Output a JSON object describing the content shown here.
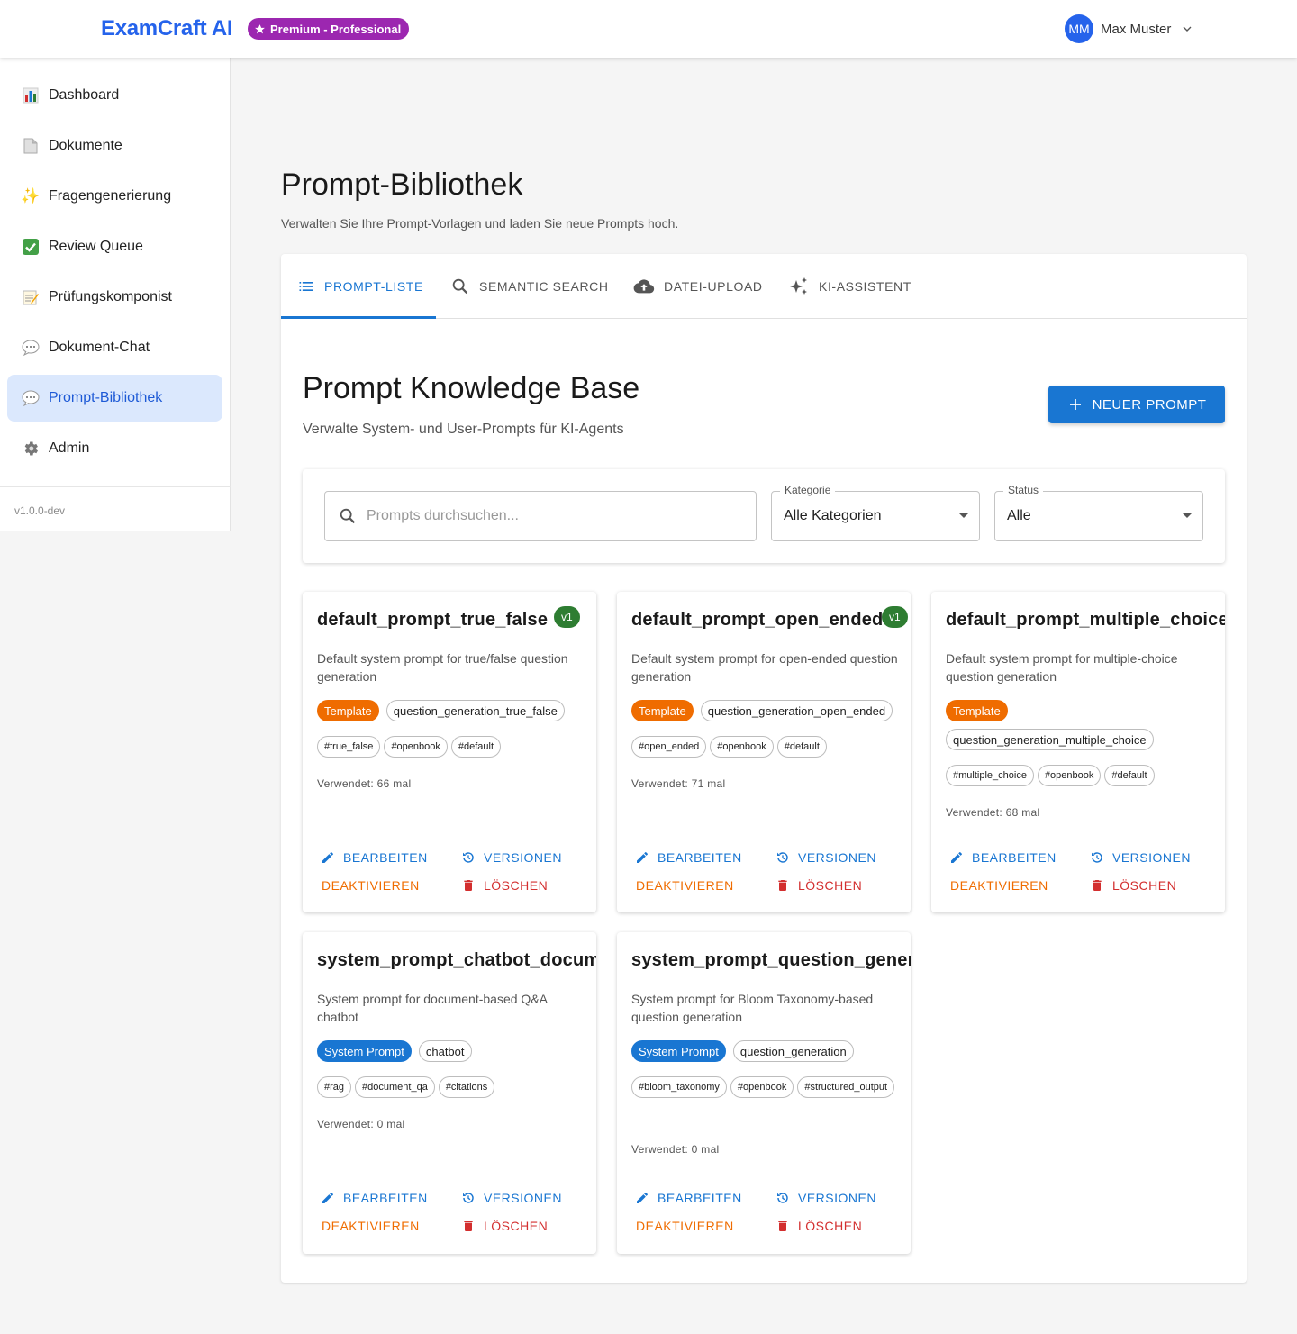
{
  "header": {
    "brand": "ExamCraft AI",
    "plan_badge": "Premium - Professional",
    "user_initials": "MM",
    "user_name": "Max Muster"
  },
  "sidebar": {
    "items": [
      {
        "label": "Dashboard",
        "icon": "bar-chart-icon"
      },
      {
        "label": "Dokumente",
        "icon": "document-icon"
      },
      {
        "label": "Fragengenerierung",
        "icon": "sparkles-icon"
      },
      {
        "label": "Review Queue",
        "icon": "check-box-icon"
      },
      {
        "label": "Prüfungskomponist",
        "icon": "memo-icon"
      },
      {
        "label": "Dokument-Chat",
        "icon": "speech-bubble-icon"
      },
      {
        "label": "Prompt-Bibliothek",
        "icon": "speech-bubble-icon",
        "active": true
      },
      {
        "label": "Admin",
        "icon": "gear-icon"
      }
    ],
    "version": "v1.0.0-dev"
  },
  "page": {
    "title": "Prompt-Bibliothek",
    "subtitle": "Verwalten Sie Ihre Prompt-Vorlagen und laden Sie neue Prompts hoch."
  },
  "tabs": [
    {
      "label": "PROMPT-LISTE",
      "icon": "list-icon",
      "active": true
    },
    {
      "label": "SEMANTIC SEARCH",
      "icon": "search-icon"
    },
    {
      "label": "DATEI-UPLOAD",
      "icon": "cloud-upload-icon"
    },
    {
      "label": "KI-ASSISTENT",
      "icon": "ai-sparkle-icon"
    }
  ],
  "kb": {
    "title": "Prompt Knowledge Base",
    "subtitle": "Verwalte System- und User-Prompts für KI-Agents",
    "new_button": "NEUER PROMPT"
  },
  "filters": {
    "search_placeholder": "Prompts durchsuchen...",
    "category_label": "Kategorie",
    "category_value": "Alle Kategorien",
    "status_label": "Status",
    "status_value": "Alle"
  },
  "actions": {
    "edit": "BEARBEITEN",
    "versions": "VERSIONEN",
    "deactivate": "DEAKTIVIEREN",
    "delete": "LÖSCHEN"
  },
  "cards": [
    {
      "title": "default_prompt_true_false",
      "version": "v1",
      "description": "Default system prompt for true/false question generation",
      "type": "Template",
      "category": "question_generation_true_false",
      "tags": [
        "#true_false",
        "#openbook",
        "#default"
      ],
      "usage": "Verwendet: 66 mal"
    },
    {
      "title": "default_prompt_open_ended",
      "version": "v1",
      "description": "Default system prompt for open-ended question generation",
      "type": "Template",
      "category": "question_generation_open_ended",
      "tags": [
        "#open_ended",
        "#openbook",
        "#default"
      ],
      "usage": "Verwendet: 71 mal"
    },
    {
      "title": "default_prompt_multiple_choice",
      "version": "",
      "description": "Default system prompt for multiple-choice question generation",
      "type": "Template",
      "category": "question_generation_multiple_choice",
      "tags": [
        "#multiple_choice",
        "#openbook",
        "#default"
      ],
      "usage": "Verwendet: 68 mal"
    },
    {
      "title": "system_prompt_chatbot_document_qa",
      "version": "",
      "description": "System prompt for document-based Q&A chatbot",
      "type": "System Prompt",
      "category": "chatbot",
      "tags": [
        "#rag",
        "#document_qa",
        "#citations"
      ],
      "usage": "Verwendet: 0 mal"
    },
    {
      "title": "system_prompt_question_generation",
      "version": "",
      "description": "System prompt for Bloom Taxonomy-based question generation",
      "type": "System Prompt",
      "category": "question_generation",
      "tags": [
        "#bloom_taxonomy",
        "#openbook",
        "#structured_output"
      ],
      "usage": "Verwendet: 0 mal"
    }
  ],
  "colors": {
    "brand": "#2563eb",
    "primary": "#1976d2",
    "premium": "#9c27b0",
    "template": "#ef6c00",
    "version_badge": "#2e7d32",
    "danger": "#d32f2f"
  }
}
